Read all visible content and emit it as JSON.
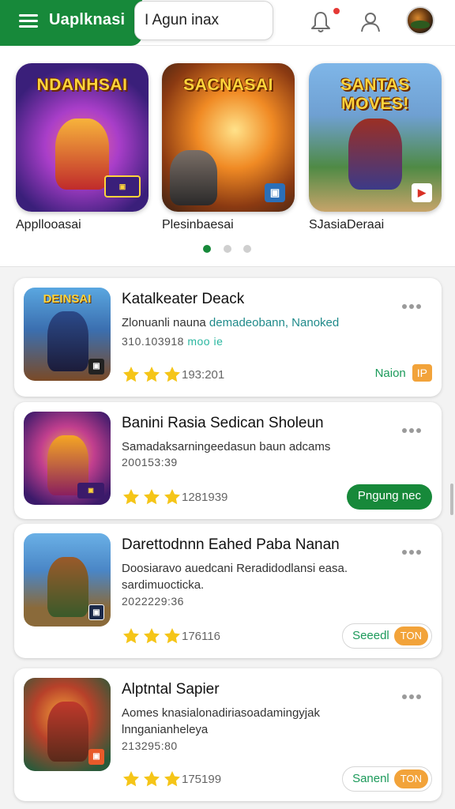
{
  "header": {
    "brand_title": "Uaplknasi",
    "search_value": "I Agun inax",
    "notification_icon": "bell-icon",
    "user_icon": "user-icon",
    "brand_color": "#17893a"
  },
  "featured": {
    "cards": [
      {
        "art_title": "NDANHSAI",
        "label": "Appllooasai"
      },
      {
        "art_title": "SACNASAI",
        "label": "Plesinbaesai"
      },
      {
        "art_title": "SANTAS MOVES!",
        "label": "SJasiaDeraai"
      }
    ]
  },
  "apps": [
    {
      "thumb_title": "DEINSAI",
      "name": "Katalkeater Deack",
      "desc_plain": "Zlonuanli nauna ",
      "desc_highlight": "demadeobann, Nanoked",
      "meta": "310.103918",
      "meta_highlight": "moo ie",
      "count": "193:201",
      "action_label": "Naion",
      "action_tag": "IP"
    },
    {
      "name": "Banini Rasia Sedican Sholeun",
      "desc": "Samadaksarningeedasun baun adcams",
      "meta": "200153:39",
      "count": "1281939",
      "action_label": "Pngung nec"
    },
    {
      "name": "Darettodnnn Eahed Paba Nanan",
      "desc": "Doosiaravo auedcani Reradidodlansi easa. sardimuocticka.",
      "meta": "2022229:36",
      "count": "176116",
      "action_label": "Seeedl",
      "action_tag": "TON"
    },
    {
      "name": "Alptntal Sapier",
      "desc": "Aomes knasialonadiriasoadamingyjak lnnganianheleya",
      "meta": "213295:80",
      "count": "175199",
      "action_label": "Sanenl",
      "action_tag": "TON"
    }
  ]
}
